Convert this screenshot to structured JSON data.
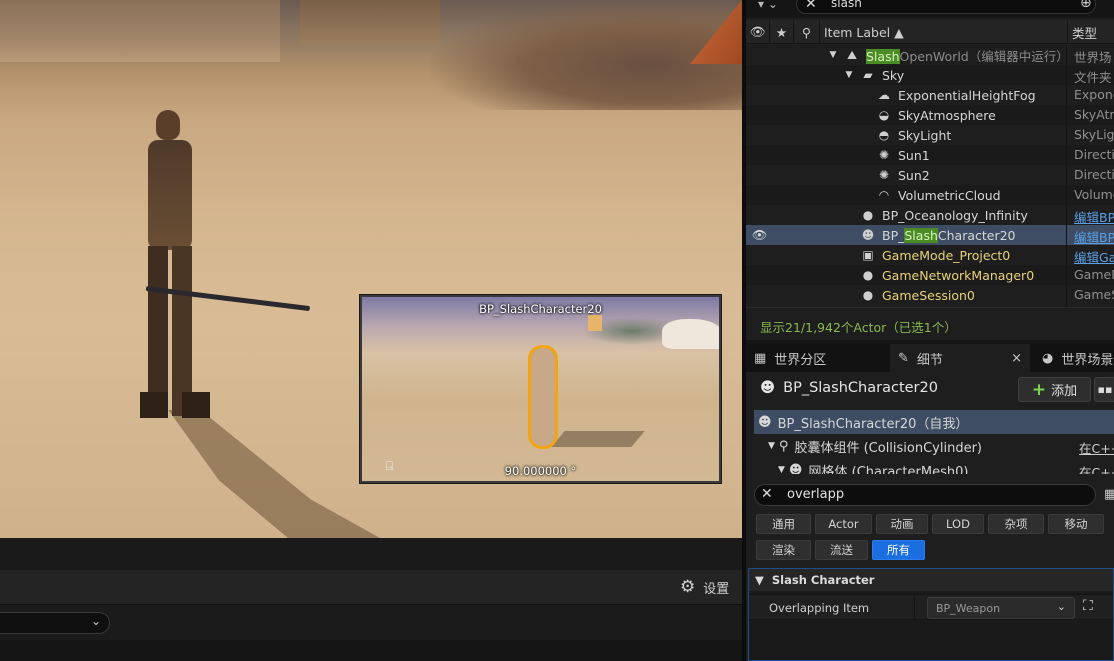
{
  "viewport": {
    "preview": {
      "label": "BP_SlashCharacter20",
      "angle": "90.000000 °"
    }
  },
  "bottom": {
    "settings_label": "设置"
  },
  "outliner": {
    "search_text": "slash",
    "header": {
      "label_col": "Item Label ▲",
      "type_col": "类型"
    },
    "rows": [
      {
        "pre": "",
        "hl": "Slash",
        "post": "OpenWorld（编辑器中运行）",
        "type": "世界场",
        "depth": 0,
        "icon": "⛰",
        "arrow": "▼",
        "dim": true
      },
      {
        "pre": "Sky",
        "hl": "",
        "post": "",
        "type": "文件夹",
        "depth": 1,
        "icon": "▰",
        "arrow": "▼"
      },
      {
        "pre": "ExponentialHeightFog",
        "hl": "",
        "post": "",
        "type": "Expone",
        "depth": 2,
        "icon": "☁",
        "arrow": ""
      },
      {
        "pre": "SkyAtmosphere",
        "hl": "",
        "post": "",
        "type": "SkyAtm",
        "depth": 2,
        "icon": "◒",
        "arrow": ""
      },
      {
        "pre": "SkyLight",
        "hl": "",
        "post": "",
        "type": "SkyLigh",
        "depth": 2,
        "icon": "◓",
        "arrow": ""
      },
      {
        "pre": "Sun1",
        "hl": "",
        "post": "",
        "type": "Directio",
        "depth": 2,
        "icon": "✺",
        "arrow": ""
      },
      {
        "pre": "Sun2",
        "hl": "",
        "post": "",
        "type": "Directio",
        "depth": 2,
        "icon": "✺",
        "arrow": ""
      },
      {
        "pre": "VolumetricCloud",
        "hl": "",
        "post": "",
        "type": "Volume",
        "depth": 2,
        "icon": "◠",
        "arrow": ""
      },
      {
        "pre": "BP_Oceanology_Infinity",
        "hl": "",
        "post": "",
        "type": "编辑BP",
        "depth": 1,
        "icon": "●",
        "arrow": "",
        "link": true
      },
      {
        "pre": "BP_",
        "hl": "Slash",
        "post": "Character20",
        "type": "编辑BP",
        "depth": 1,
        "icon": "☻",
        "arrow": "",
        "link": true,
        "selected": true,
        "eye": true
      },
      {
        "pre": "GameMode_Project0",
        "hl": "",
        "post": "",
        "type": "编辑Ga",
        "depth": 1,
        "icon": "▣",
        "arrow": "",
        "link": true,
        "yellow": true
      },
      {
        "pre": "GameNetworkManager0",
        "hl": "",
        "post": "",
        "type": "GameN",
        "depth": 1,
        "icon": "●",
        "arrow": "",
        "yellow": true
      },
      {
        "pre": "GameSession0",
        "hl": "",
        "post": "",
        "type": "GameS",
        "depth": 1,
        "icon": "●",
        "arrow": "",
        "yellow": true
      }
    ],
    "status": "显示21/1,942个Actor（已选1个）"
  },
  "tabs": [
    {
      "label": "世界分区",
      "icon": "▦"
    },
    {
      "label": "细节",
      "icon": "✎",
      "close": "×"
    },
    {
      "label": "世界场景",
      "icon": "◕"
    }
  ],
  "details": {
    "title": "BP_SlashCharacter20",
    "add_label": "添加",
    "components": [
      {
        "label": "BP_SlashCharacter20（自我）",
        "right": "",
        "depth": 0,
        "icon": "☻",
        "arrow": ""
      },
      {
        "label": "胶囊体组件 (CollisionCylinder)",
        "right": "在C++",
        "depth": 1,
        "icon": "⚲",
        "arrow": "▼"
      },
      {
        "label": "网格体 (CharacterMesh0)",
        "right": "在C++",
        "depth": 2,
        "icon": "☻",
        "arrow": "▼"
      }
    ],
    "search_text": "overlapp",
    "filters_row1": [
      "通用",
      "Actor",
      "动画",
      "LOD",
      "杂项",
      "移动"
    ],
    "filters_row2": [
      "渲染",
      "流送",
      "所有"
    ],
    "active_filter": "所有",
    "section": {
      "title": "Slash Character",
      "property_label": "Overlapping Item",
      "property_value": "BP_Weapon"
    }
  }
}
